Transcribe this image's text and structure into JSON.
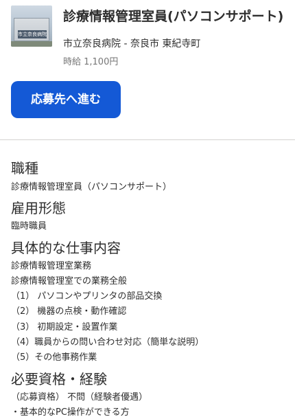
{
  "job": {
    "thumbnail_icon": "hospital-building-photo",
    "thumbnail_sign": "市立奈良病院",
    "title": "診療情報管理室員(パソコンサポート)",
    "location": "市立奈良病院 - 奈良市 東紀寺町",
    "wage": "時給 1,100円",
    "apply_label": "応募先へ進む",
    "accent_color": "#1459d6"
  },
  "details": [
    {
      "heading": "職種",
      "lines": [
        "診療情報管理室員（パソコンサポート）"
      ]
    },
    {
      "heading": "雇用形態",
      "lines": [
        "臨時職員"
      ]
    },
    {
      "heading": "具体的な仕事内容",
      "lines": [
        "診療情報管理室業務",
        "診療情報管理室での業務全般",
        "（1） パソコンやプリンタの部品交換",
        "（2） 機器の点検・動作確認",
        "（3） 初期設定・設置作業",
        "（4）職員からの問い合わせ対応（簡単な説明）",
        "（5）その他事務作業"
      ]
    },
    {
      "heading": "必要資格・経験",
      "lines": [
        "（応募資格） 不問（経験者優遇）",
        "・基本的なPC操作ができる方"
      ]
    }
  ]
}
